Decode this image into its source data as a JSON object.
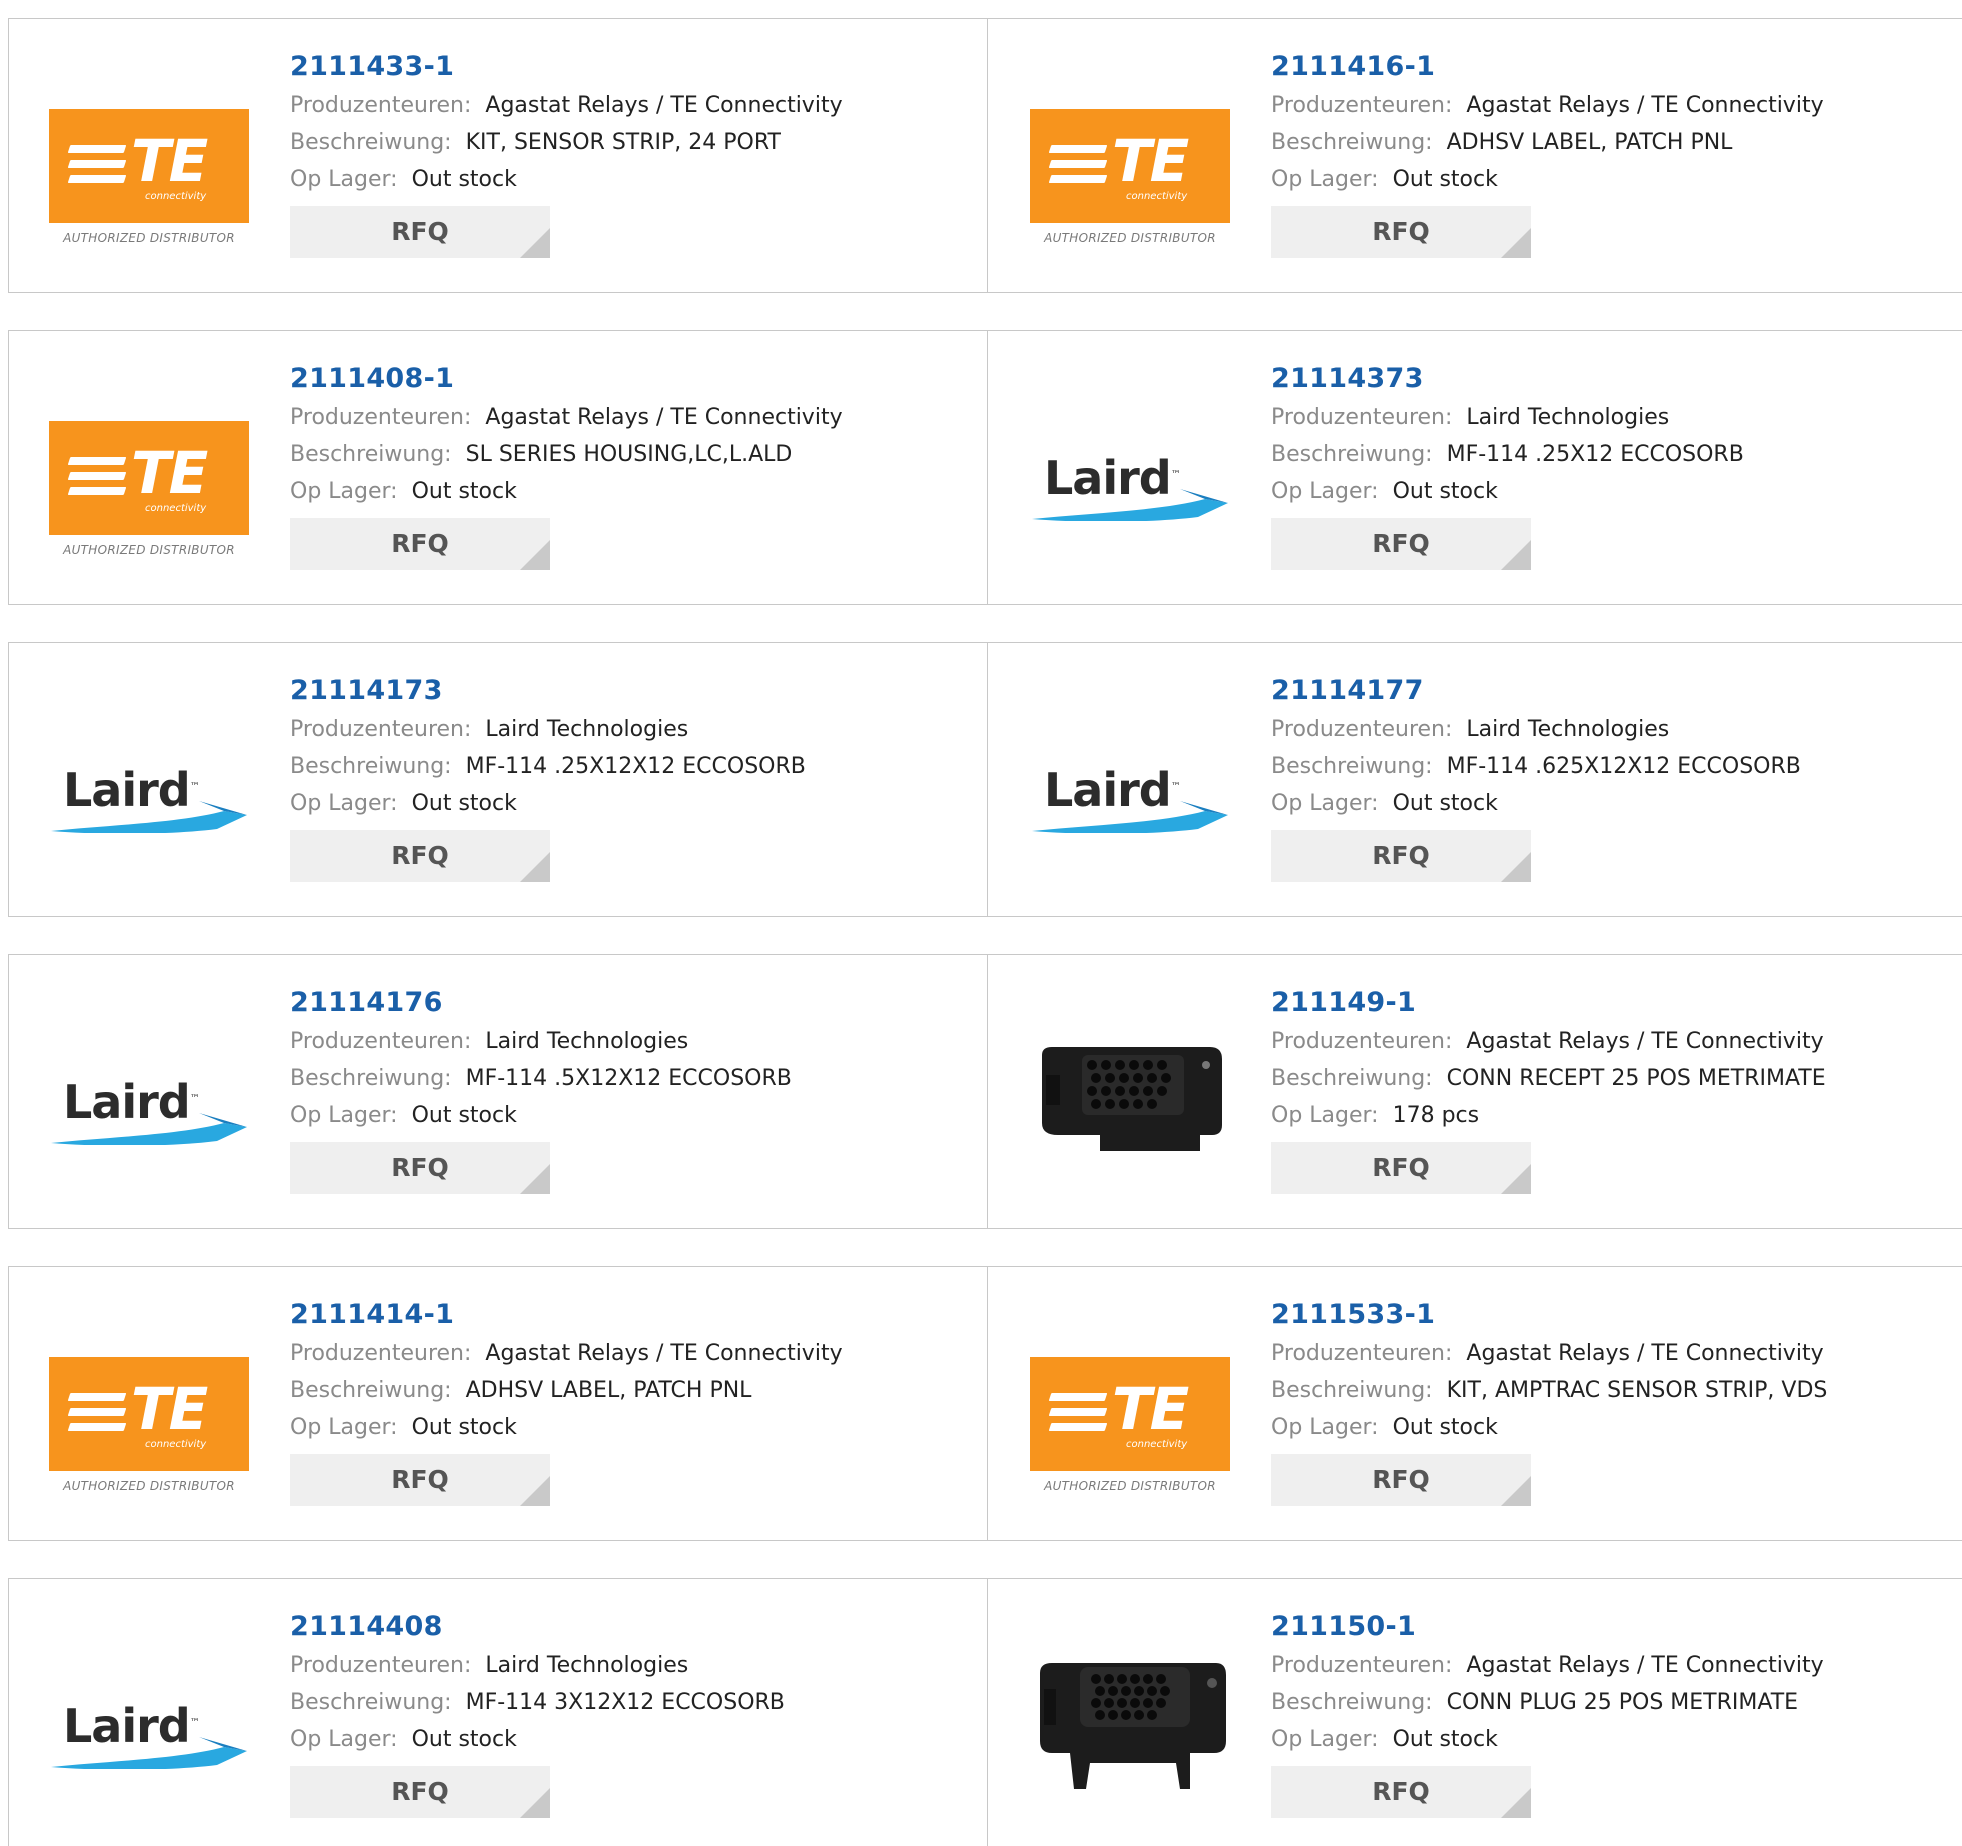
{
  "labels": {
    "manufacturer": "Produzenteuren:",
    "description": "Beschreiwung:",
    "stock": "Op Lager:",
    "rfq": "RFQ"
  },
  "logos": {
    "te": {
      "wordmark": "TE",
      "sub": "connectivity",
      "tagline": "AUTHORIZED DISTRIBUTOR",
      "color": "#f7941d"
    },
    "laird": {
      "wordmark": "Laird",
      "tm": "™"
    }
  },
  "colors": {
    "part_link": "#1a5fa8",
    "label": "#8a8a8a",
    "border": "#c8c8c8",
    "button": "#efefef"
  },
  "rows": [
    [
      {
        "part": "2111433-1",
        "manufacturer": "Agastat Relays / TE Connectivity",
        "description": "KIT, SENSOR STRIP, 24 PORT",
        "stock": "Out stock",
        "logo": "te"
      },
      {
        "part": "2111416-1",
        "manufacturer": "Agastat Relays / TE Connectivity",
        "description": "ADHSV LABEL, PATCH PNL",
        "stock": "Out stock",
        "logo": "te"
      }
    ],
    [
      {
        "part": "2111408-1",
        "manufacturer": "Agastat Relays / TE Connectivity",
        "description": "SL SERIES HOUSING,LC,L.ALD",
        "stock": "Out stock",
        "logo": "te"
      },
      {
        "part": "21114373",
        "manufacturer": "Laird Technologies",
        "description": "MF-114 .25X12 ECCOSORB",
        "stock": "Out stock",
        "logo": "laird"
      }
    ],
    [
      {
        "part": "21114173",
        "manufacturer": "Laird Technologies",
        "description": "MF-114 .25X12X12 ECCOSORB",
        "stock": "Out stock",
        "logo": "laird"
      },
      {
        "part": "21114177",
        "manufacturer": "Laird Technologies",
        "description": "MF-114 .625X12X12 ECCOSORB",
        "stock": "Out stock",
        "logo": "laird"
      }
    ],
    [
      {
        "part": "21114176",
        "manufacturer": "Laird Technologies",
        "description": "MF-114 .5X12X12 ECCOSORB",
        "stock": "Out stock",
        "logo": "laird"
      },
      {
        "part": "211149-1",
        "manufacturer": "Agastat Relays / TE Connectivity",
        "description": "CONN RECEPT 25 POS METRIMATE",
        "stock": "178 pcs",
        "logo": "connector-receptacle"
      }
    ],
    [
      {
        "part": "2111414-1",
        "manufacturer": "Agastat Relays / TE Connectivity",
        "description": "ADHSV LABEL, PATCH PNL",
        "stock": "Out stock",
        "logo": "te"
      },
      {
        "part": "2111533-1",
        "manufacturer": "Agastat Relays / TE Connectivity",
        "description": "KIT, AMPTRAC SENSOR STRIP, VDS",
        "stock": "Out stock",
        "logo": "te"
      }
    ],
    [
      {
        "part": "21114408",
        "manufacturer": "Laird Technologies",
        "description": "MF-114 3X12X12 ECCOSORB",
        "stock": "Out stock",
        "logo": "laird"
      },
      {
        "part": "211150-1",
        "manufacturer": "Agastat Relays / TE Connectivity",
        "description": "CONN PLUG 25 POS METRIMATE",
        "stock": "Out stock",
        "logo": "connector-plug"
      }
    ]
  ]
}
